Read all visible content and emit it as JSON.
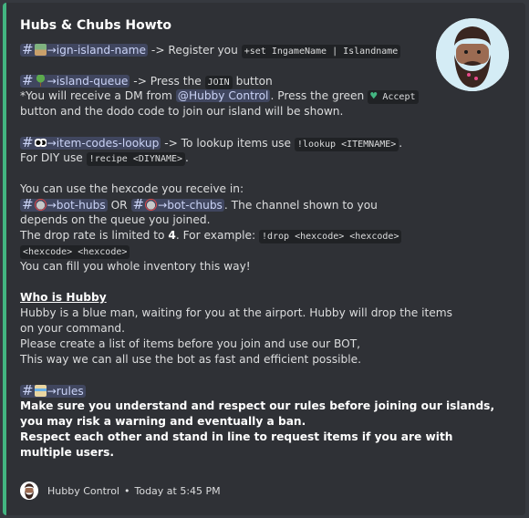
{
  "embed": {
    "title": "Hubs & Chubs Howto",
    "accent_color": "#43b581",
    "lines": {
      "l1_channel": "→ign-island-name",
      "l1_text": "-> Register you",
      "l1_code": "+set IngameName | Islandname",
      "l2_channel": "→island-queue",
      "l2_text_a": "-> Press the",
      "l2_code": "JOIN",
      "l2_text_b": "button",
      "l3_text_a": "*You will receive a DM from",
      "l3_mention": "@Hubby Control",
      "l3_text_b": ". Press the green",
      "l3_code": "Accept",
      "l4_text": "button and the dodo code to join our island will be shown.",
      "l5_channel": "→item-codes-lookup",
      "l5_text": "-> To lookup items use",
      "l5_code": "!lookup <ITEMNAME>",
      "l5_end": ".",
      "l6_text": "For DIY use",
      "l6_code": "!recipe <DIYNAME>",
      "l6_end": ".",
      "l7_text": "You can use the hexcode you receive in:",
      "l8_channel_a": "→bot-hubs",
      "l8_or": "OR",
      "l8_channel_b": "→bot-chubs",
      "l8_text": ". The channel shown to you",
      "l9_text": "depends on the queue you joined.",
      "l10_text_a": "The drop rate is limited to",
      "l10_bold": "4",
      "l10_text_b": ". For example:",
      "l10_code": "!drop <hexcode> <hexcode>",
      "l11_code": "<hexcode> <hexcode>",
      "l12_text": "You can fill you whole inventory this way!",
      "l13_heading": "Who is Hubby",
      "l14_text": "Hubby is a blue man, waiting for you at the airport. Hubby will drop the items",
      "l15_text": "on your command.",
      "l16_text": "Please create a list of items before you join and use our BOT,",
      "l17_text": "This way we can all use the bot as fast and efficient possible.",
      "l18_channel": "→rules",
      "l19_bold": "Make sure you understand and respect our rules before joining our islands,",
      "l20_bold": "you may risk a warning and eventually a ban.",
      "l21_bold": "Respect each other and stand in line to request items if you are with",
      "l22_bold": "multiple users."
    },
    "footer": {
      "author": "Hubby Control",
      "separator": "•",
      "timestamp": "Today at 5:45 PM"
    }
  }
}
